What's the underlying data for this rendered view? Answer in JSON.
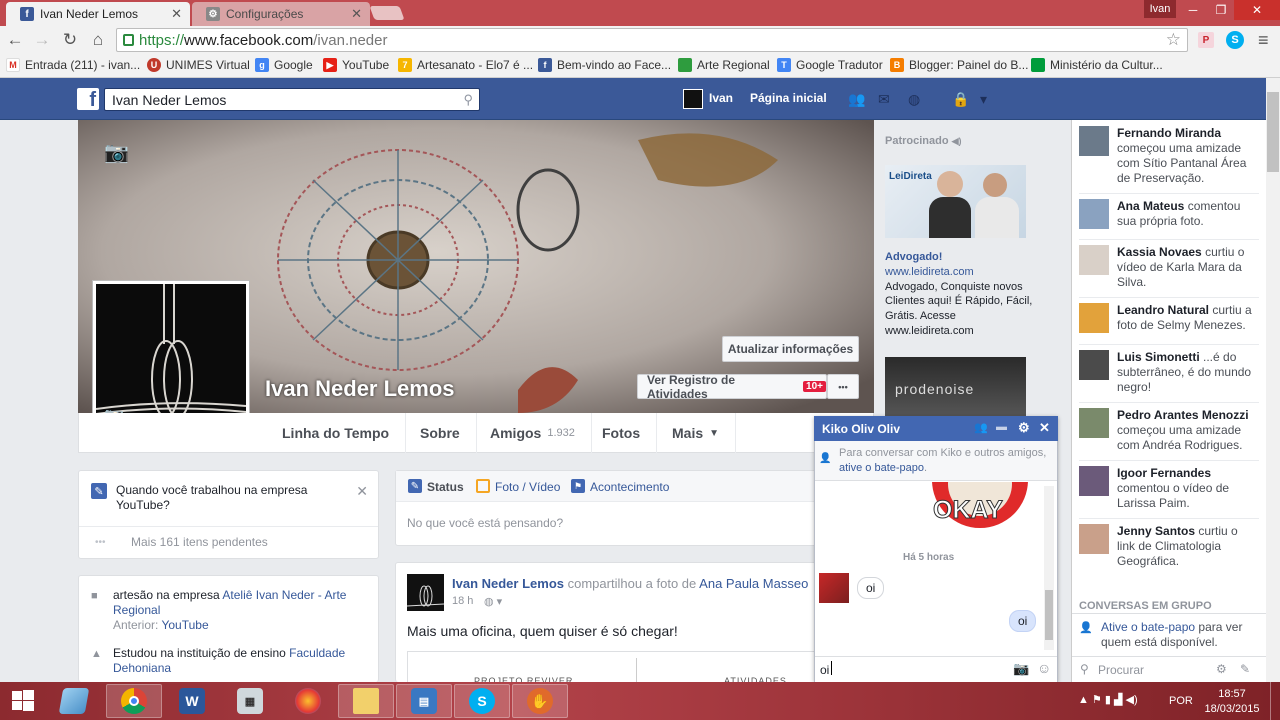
{
  "browser": {
    "tabs": [
      {
        "title": "Ivan Neder Lemos",
        "active": true
      },
      {
        "title": "Configurações",
        "active": false
      }
    ],
    "window_user": "Ivan",
    "url_scheme": "https://",
    "url_host": "www.facebook.com",
    "url_path": "/ivan.neder",
    "bookmarks": [
      "Entrada (211) - ivan...",
      "UNIMES Virtual",
      "Google",
      "YouTube",
      "Artesanato - Elo7 é ...",
      "Bem-vindo ao Face...",
      "Arte Regional",
      "Google Tradutor",
      "Blogger: Painel do B...",
      "Ministério da Cultur..."
    ]
  },
  "fb_header": {
    "search_value": "Ivan Neder Lemos",
    "user": "Ivan",
    "home": "Página inicial"
  },
  "profile": {
    "name": "Ivan Neder Lemos",
    "update_info": "Atualizar informações",
    "activity_log": "Ver Registro de Atividades",
    "activity_badge": "10+",
    "more_dots": "•••",
    "tabs": {
      "timeline": "Linha do Tempo",
      "about": "Sobre",
      "friends": "Amigos",
      "friends_count": "1.932",
      "photos": "Fotos",
      "more": "Mais"
    }
  },
  "left_col": {
    "prompt": "Quando você trabalhou na empresa YouTube?",
    "pending": "Mais 161 itens pendentes",
    "work_prefix": "artesão na empresa",
    "work_company": "Ateliê Ivan Neder - Arte Regional",
    "previous_label": "Anterior:",
    "previous_company": "YouTube",
    "study_prefix": "Estudou na instituição de ensino",
    "study_school": "Faculdade Dehoniana"
  },
  "composer": {
    "status": "Status",
    "photo_video": "Foto / Vídeo",
    "event": "Acontecimento",
    "placeholder": "No que você está pensando?"
  },
  "post": {
    "author": "Ivan Neder Lemos",
    "action": "compartilhou a foto de",
    "shared_from": "Ana Paula Masseo",
    "time": "18 h",
    "text": "Mais uma oficina, quem quiser é só chegar!",
    "preview_left": "PROJETO REVIVER",
    "preview_right": "ATIVIDADES"
  },
  "ads": {
    "sponsored": "Patrocinado",
    "ad1_logo": "LeiDireta",
    "ad1_title": "Advogado!",
    "ad1_domain": "www.leidireta.com",
    "ad1_body": "Advogado, Conquiste novos Clientes aqui! É Rápido, Fácil, Grátis. Acesse",
    "ad1_url": "www.leidireta.com",
    "ad2_text": "prodenoise"
  },
  "ticker": [
    {
      "name": "Fernando Miranda",
      "text": "começou uma amizade com Sítio Pantanal Área de Preservação."
    },
    {
      "name": "Ana Mateus",
      "text": "comentou sua própria foto."
    },
    {
      "name": "Kassia Novaes",
      "text": "curtiu o vídeo de Karla Mara da Silva."
    },
    {
      "name": "Leandro Natural",
      "text": "curtiu a foto de Selmy Menezes."
    },
    {
      "name": "Luis Simonetti",
      "text": "...é do subterrâneo, é do mundo negro!"
    },
    {
      "name": "Pedro Arantes Menozzi",
      "text": "começou uma amizade com Andréa Rodrigues."
    },
    {
      "name": "Igoor Fernandes",
      "text": "comentou o vídeo de Larissa Paim."
    },
    {
      "name": "Jenny Santos",
      "text": "curtiu o link de Climatologia Geográfica."
    }
  ],
  "sidebar_chat": {
    "group_header": "CONVERSAS EM GRUPO",
    "activate_link": "Ative o bate-papo",
    "activate_rest": "para ver quem está disponível.",
    "search_placeholder": "Procurar"
  },
  "chat": {
    "title": "Kiko Oliv Oliv",
    "notice_prefix": "Para conversar com Kiko e outros amigos,",
    "notice_link": "ative o bate-papo",
    "sticker_text": "OKAY",
    "timestamp": "Há 5 horas",
    "msg_in": "oi",
    "msg_out": "oi",
    "input_value": "oi"
  },
  "taskbar": {
    "lang": "POR",
    "time": "18:57",
    "date": "18/03/2015"
  },
  "colors": {
    "fb_blue": "#3b5998",
    "chat_blue": "#4267b2",
    "tab_strip": "#c04a4f",
    "badge_red": "#e41e3f"
  }
}
